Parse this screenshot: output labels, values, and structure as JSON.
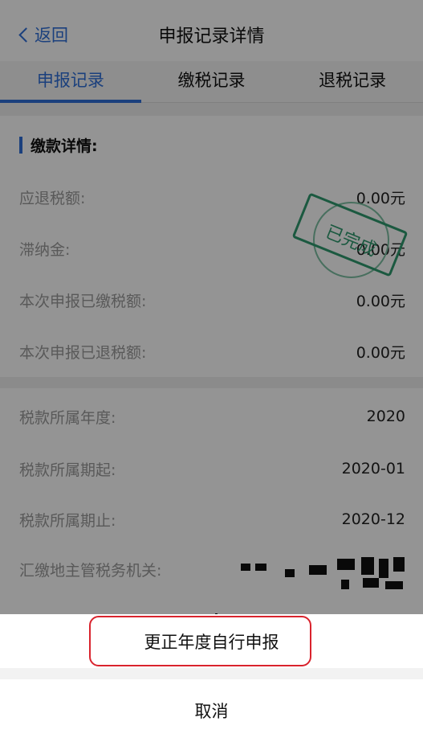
{
  "navbar": {
    "back_label": "返回",
    "title": "申报记录详情"
  },
  "tabs": [
    {
      "label": "申报记录"
    },
    {
      "label": "缴税记录"
    },
    {
      "label": "退税记录"
    }
  ],
  "payment": {
    "section_title": "缴款详情:",
    "rows": [
      {
        "label": "应退税额:",
        "value": "0.00元"
      },
      {
        "label": "滞纳金:",
        "value": "0.00元"
      },
      {
        "label": "本次申报已缴税额:",
        "value": "0.00元"
      },
      {
        "label": "本次申报已退税额:",
        "value": "0.00元"
      }
    ],
    "stamp_text": "已完成",
    "stamp_color": "#2f9a6e"
  },
  "tax_info": {
    "rows": [
      {
        "label": "税款所属年度:",
        "value": "2020"
      },
      {
        "label": "税款所属期起:",
        "value": "2020-01"
      },
      {
        "label": "税款所属期止:",
        "value": "2020-12"
      },
      {
        "label": "汇缴地主管税务机关:",
        "value": ""
      }
    ]
  },
  "action_sheet": {
    "option_label": "更正年度自行申报",
    "cancel_label": "取消",
    "highlight_color": "#d9232d"
  },
  "colors": {
    "accent": "#2f6fd8",
    "overlay": "rgba(0,0,0,0.42)"
  }
}
